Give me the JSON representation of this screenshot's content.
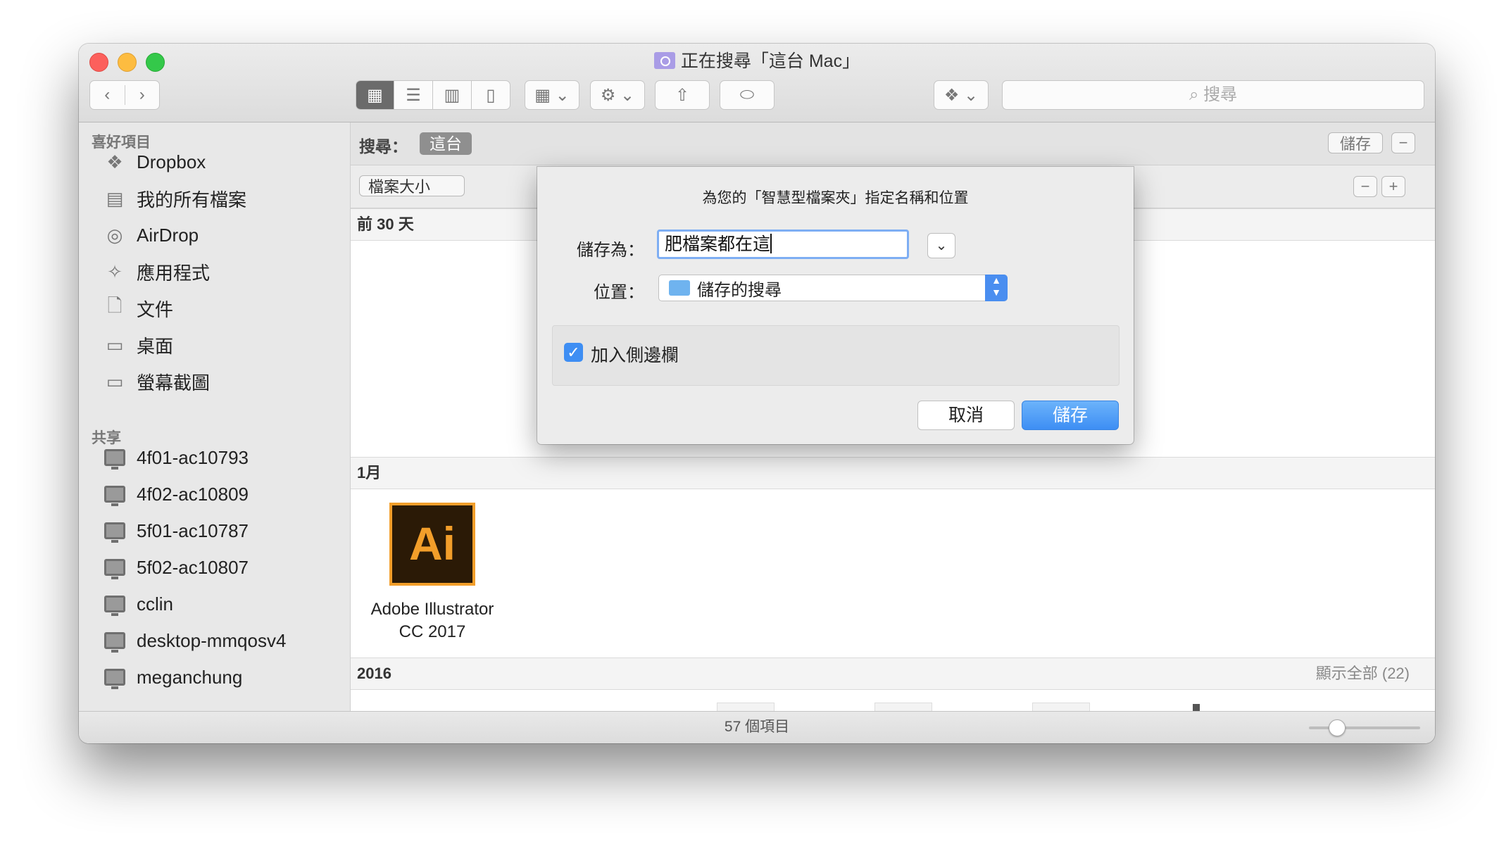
{
  "window": {
    "title": "正在搜尋「這台 Mac」"
  },
  "toolbar": {
    "search_placeholder": "搜尋"
  },
  "sidebar": {
    "favorites_header": "喜好項目",
    "favorites": [
      "Dropbox",
      "我的所有檔案",
      "AirDrop",
      "應用程式",
      "文件",
      "桌面",
      "螢幕截圖"
    ],
    "shared_header": "共享",
    "shared": [
      "4f01-ac10793",
      "4f02-ac10809",
      "5f01-ac10787",
      "5f02-ac10807",
      "cclin",
      "desktop-mmqosv4",
      "meganchung"
    ]
  },
  "scope": {
    "label": "搜尋：",
    "selected": "這台",
    "save": "儲存",
    "remove": "−"
  },
  "criteria": {
    "attribute": "檔案大小",
    "remove": "−",
    "add": "+"
  },
  "sections": {
    "recent": "前 30 天",
    "january": "1月",
    "year2016": "2016",
    "show_all": "顯示全部 (22)"
  },
  "files": {
    "illustrator_icon": "Ai",
    "illustrator_name": "Adobe Illustrator CC 2017"
  },
  "status": {
    "items": "57 個項目",
    "icon_size_slider": 0.25
  },
  "dialog": {
    "title": "為您的「智慧型檔案夾」指定名稱和位置",
    "save_as_label": "儲存為：",
    "save_as_value": "肥檔案都在這",
    "location_label": "位置：",
    "location_value": "儲存的搜尋",
    "add_to_sidebar": "加入側邊欄",
    "add_to_sidebar_checked": true,
    "cancel": "取消",
    "save": "儲存"
  },
  "colors": {
    "accent": "#3d8ef4",
    "illustrator_bg": "#2b1a06",
    "illustrator_fg": "#f29e2a"
  }
}
